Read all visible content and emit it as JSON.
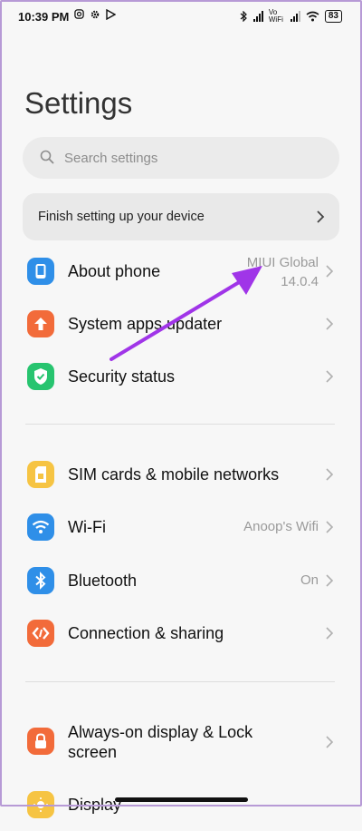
{
  "status_bar": {
    "time": "10:39 PM",
    "network_label": "Vo WiFi",
    "battery": "83"
  },
  "page": {
    "title": "Settings",
    "search_placeholder": "Search settings",
    "setup_banner": "Finish setting up your device"
  },
  "rows": {
    "about": {
      "label": "About phone",
      "value_line1": "MIUI Global",
      "value_line2": "14.0.4",
      "icon": "phone-icon",
      "color": "#2f8fe8"
    },
    "updater": {
      "label": "System apps updater",
      "icon": "arrow-up-icon",
      "color": "#f26b3a"
    },
    "security": {
      "label": "Security status",
      "icon": "shield-check-icon",
      "color": "#27c46f"
    },
    "sim": {
      "label": "SIM cards & mobile networks",
      "icon": "sim-card-icon",
      "color": "#f6c443"
    },
    "wifi": {
      "label": "Wi-Fi",
      "value": "Anoop's Wifi",
      "icon": "wifi-icon",
      "color": "#2f8fe8"
    },
    "bluetooth": {
      "label": "Bluetooth",
      "value": "On",
      "icon": "bluetooth-icon",
      "color": "#2f8fe8"
    },
    "connection": {
      "label": "Connection & sharing",
      "icon": "connection-icon",
      "color": "#f26b3a"
    },
    "aod": {
      "label_line1": "Always-on display & Lock",
      "label_line2": "screen",
      "icon": "lock-icon",
      "color": "#f26b3a"
    },
    "display": {
      "label": "Display",
      "icon": "sun-icon",
      "color": "#f6c443"
    }
  },
  "annotation": {
    "color": "#a035e8",
    "icon": "arrow-annotation"
  }
}
